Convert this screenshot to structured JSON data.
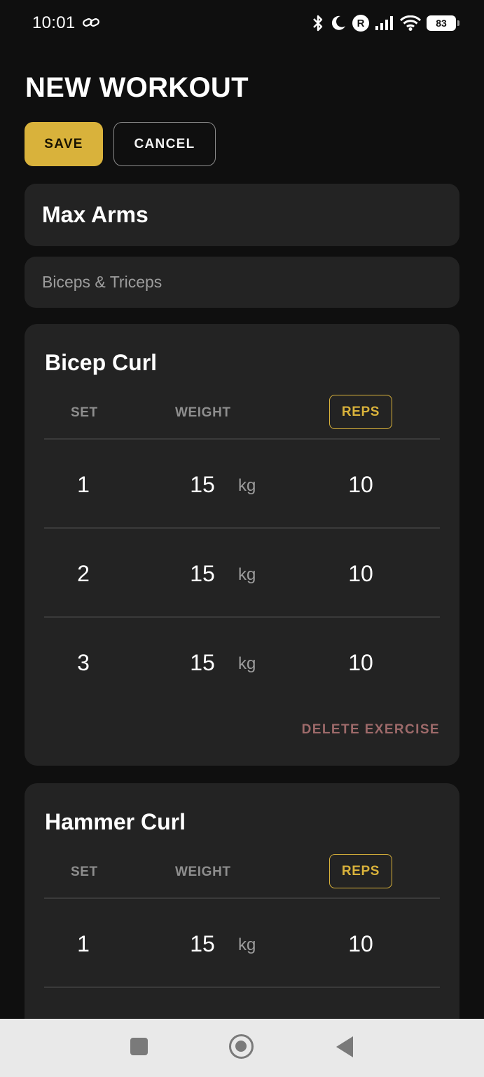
{
  "status_bar": {
    "time": "10:01",
    "battery": "83",
    "r_badge": "R",
    "icons": [
      "link-icon",
      "bluetooth-icon",
      "moon-icon",
      "r-badge-icon",
      "signal-icon",
      "wifi-icon",
      "battery-icon"
    ]
  },
  "header": {
    "title": "NEW WORKOUT",
    "save_label": "SAVE",
    "cancel_label": "CANCEL"
  },
  "workout": {
    "name": "Max Arms",
    "description": "Biceps & Triceps"
  },
  "colors": {
    "background": "#0f0f0f",
    "card": "#232323",
    "accent": "#d9b23b",
    "danger": "#9e6a6a",
    "nav_bar": "#e9e9e9"
  },
  "exercises": [
    {
      "name": "Bicep Curl",
      "col_set": "SET",
      "col_weight": "WEIGHT",
      "col_reps": "REPS",
      "sets": [
        {
          "set": "1",
          "weight": "15",
          "unit": "kg",
          "reps": "10"
        },
        {
          "set": "2",
          "weight": "15",
          "unit": "kg",
          "reps": "10"
        },
        {
          "set": "3",
          "weight": "15",
          "unit": "kg",
          "reps": "10"
        }
      ],
      "delete_label": "DELETE EXERCISE"
    },
    {
      "name": "Hammer Curl",
      "col_set": "SET",
      "col_weight": "WEIGHT",
      "col_reps": "REPS",
      "sets": [
        {
          "set": "1",
          "weight": "15",
          "unit": "kg",
          "reps": "10"
        }
      ]
    }
  ],
  "nav_bar": {
    "icons": [
      "recents-icon",
      "home-icon",
      "back-icon"
    ]
  }
}
